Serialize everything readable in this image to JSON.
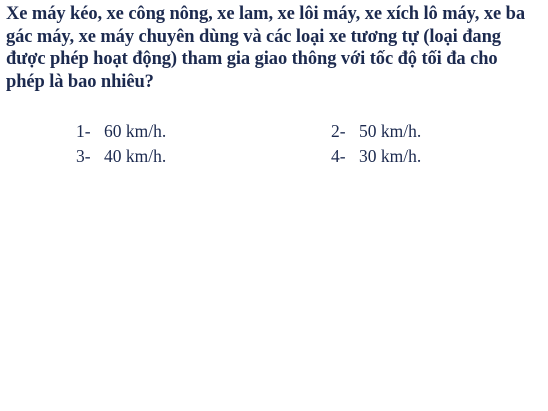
{
  "question": {
    "text": "Xe máy kéo, xe công nông, xe lam, xe lôi máy, xe xích lô máy, xe ba gác máy, xe máy chuyên dùng và các loại xe tương tự (loại đang được phép hoạt động) tham gia giao thông với tốc độ tối đa cho phép là bao nhiêu?"
  },
  "options": [
    {
      "number": "1-",
      "text": "60 km/h."
    },
    {
      "number": "2-",
      "text": "50 km/h."
    },
    {
      "number": "3-",
      "text": "40 km/h."
    },
    {
      "number": "4-",
      "text": "30 km/h."
    }
  ]
}
